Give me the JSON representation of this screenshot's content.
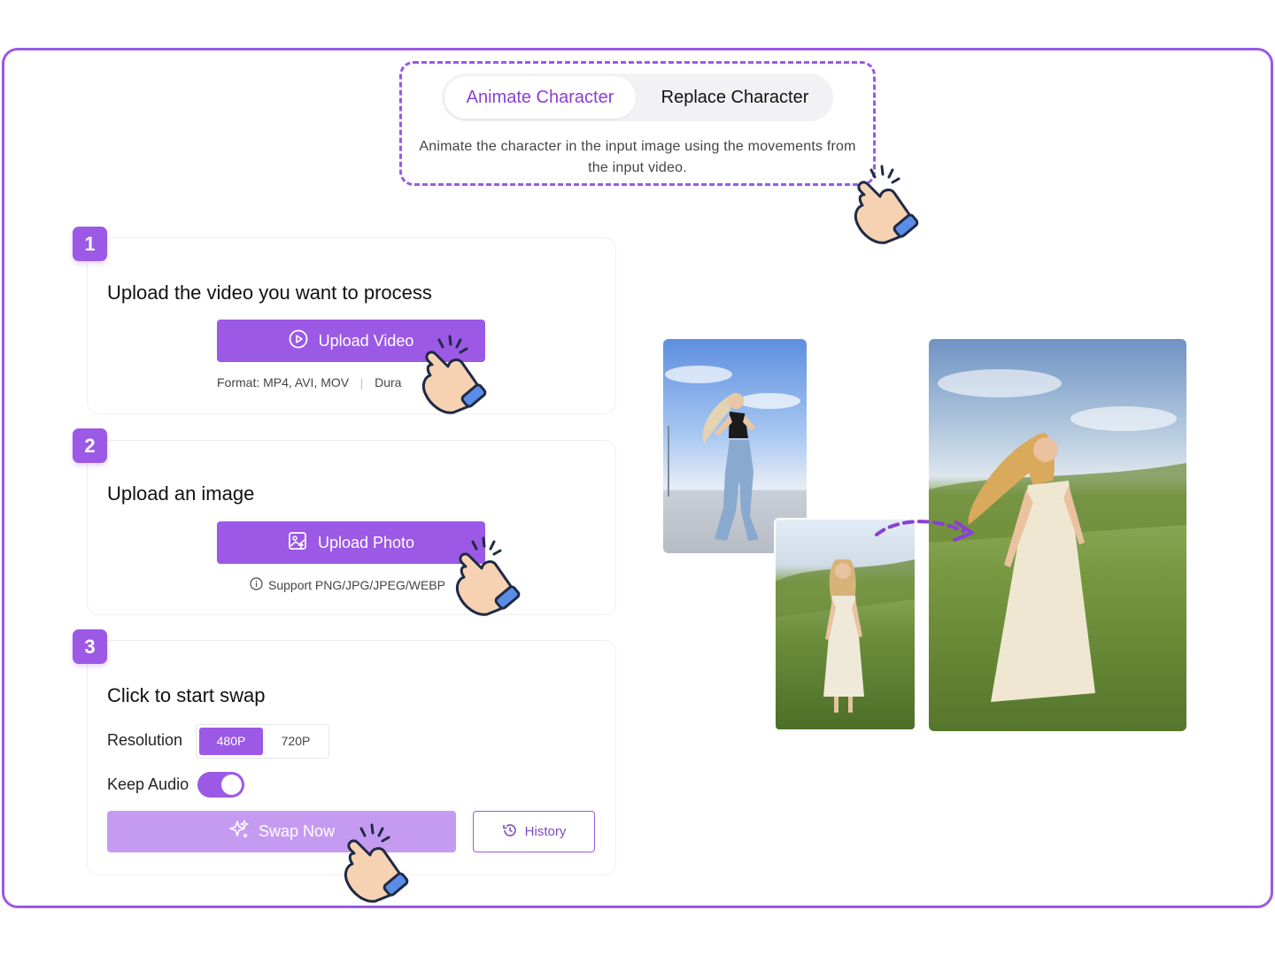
{
  "tabs": {
    "active": "Animate Character",
    "inactive": "Replace Character",
    "description": "Animate the character in the input image using the movements from the input video."
  },
  "steps": [
    {
      "number": "1",
      "title": "Upload the video you want to process",
      "button": "Upload Video",
      "hint_format": "Format: MP4, AVI, MOV",
      "hint_duration": "Dura"
    },
    {
      "number": "2",
      "title": "Upload an image",
      "button": "Upload Photo",
      "hint": "Support PNG/JPG/JPEG/WEBP"
    },
    {
      "number": "3",
      "title": "Click to start swap",
      "resolution_label": "Resolution",
      "resolution_options": [
        "480P",
        "720P"
      ],
      "resolution_selected": "480P",
      "keep_audio_label": "Keep Audio",
      "keep_audio_enabled": true,
      "swap_button": "Swap Now",
      "history_button": "History"
    }
  ],
  "colors": {
    "accent": "#9b59e6",
    "accent_light": "#c59bf2"
  },
  "icons": {
    "upload_video": "play-circle-icon",
    "upload_photo": "image-upload-icon",
    "hint": "info-icon",
    "swap": "sparkle-icon",
    "history": "history-icon",
    "pointer": "pointing-hand-icon"
  }
}
